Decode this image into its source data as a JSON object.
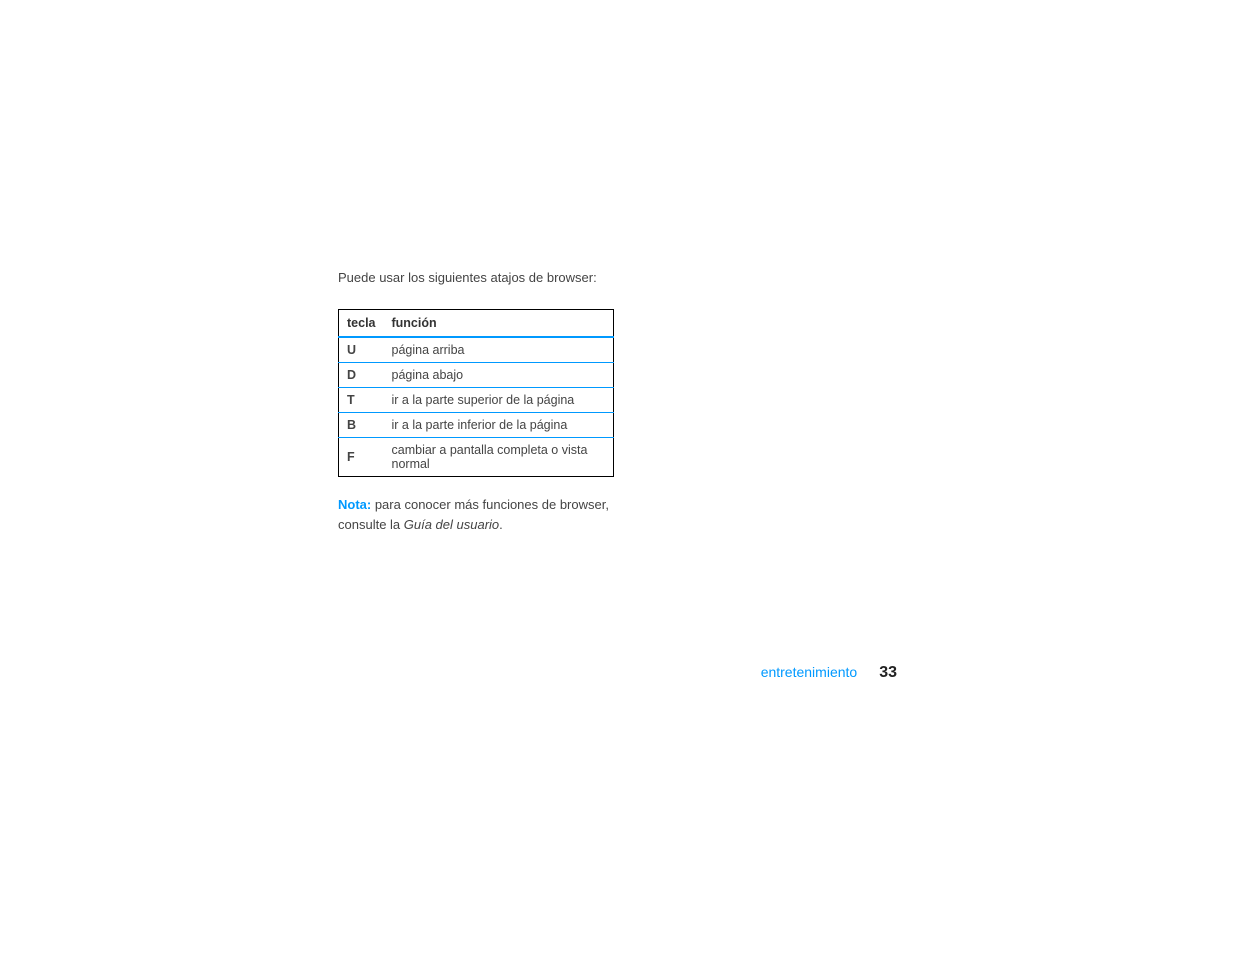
{
  "intro": "Puede usar los siguientes atajos de browser:",
  "table": {
    "headers": {
      "key": "tecla",
      "func": "función"
    },
    "rows": [
      {
        "key": "U",
        "func": "página arriba"
      },
      {
        "key": "D",
        "func": "página abajo"
      },
      {
        "key": "T",
        "func": "ir a la parte superior de la página"
      },
      {
        "key": "B",
        "func": "ir a la parte inferior de la página"
      },
      {
        "key": "F",
        "func": "cambiar a pantalla completa o vista normal"
      }
    ]
  },
  "note": {
    "label": "Nota:",
    "text1": " para conocer más funciones de browser, consulte la ",
    "guide": "Guía del usuario",
    "text2": "."
  },
  "footer": {
    "section": "entretenimiento",
    "page": "33"
  }
}
